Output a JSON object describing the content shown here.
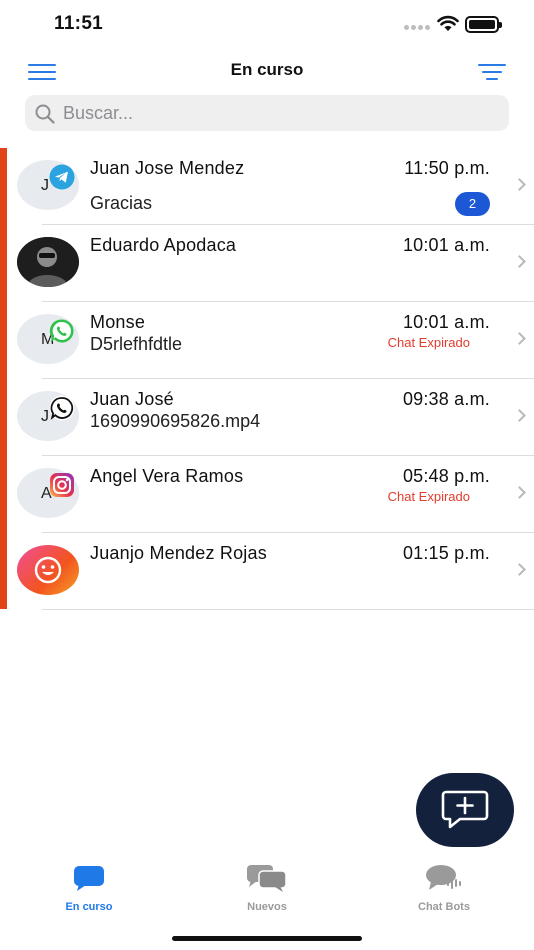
{
  "status_bar": {
    "time": "11:51"
  },
  "header": {
    "title": "En curso"
  },
  "search": {
    "placeholder": "Buscar..."
  },
  "chats": [
    {
      "name": "Juan Jose Mendez",
      "time": "11:50 p.m.",
      "preview": "Gracias",
      "initial": "J",
      "channel": "telegram-icon",
      "unread": "2",
      "expired": ""
    },
    {
      "name": "Eduardo Apodaca",
      "time": "10:01 a.m.",
      "preview": "",
      "initial": "",
      "channel": "",
      "unread": "",
      "expired": ""
    },
    {
      "name": "Monse",
      "time": "10:01 a.m.",
      "preview": "D5rlefhfdtle",
      "initial": "M",
      "channel": "whatsapp-icon",
      "unread": "",
      "expired": "Chat Expirado"
    },
    {
      "name": "Juan José",
      "time": "09:38 a.m.",
      "preview": "1690990695826.mp4",
      "initial": "J",
      "channel": "whatsapp-outline-icon",
      "unread": "",
      "expired": ""
    },
    {
      "name": "Angel Vera Ramos",
      "time": "05:48 p.m.",
      "preview": "",
      "initial": "A",
      "channel": "instagram-icon",
      "unread": "",
      "expired": "Chat Expirado"
    },
    {
      "name": "Juanjo Mendez Rojas",
      "time": "01:15 p.m.",
      "preview": "",
      "initial": "",
      "channel": "",
      "unread": "",
      "expired": ""
    }
  ],
  "tabs": [
    {
      "label": "En curso",
      "icon": "chat-bubble-icon",
      "active": true
    },
    {
      "label": "Nuevos",
      "icon": "chat-bubbles-icon",
      "active": false
    },
    {
      "label": "Chat Bots",
      "icon": "chatbot-icon",
      "active": false
    }
  ],
  "colors": {
    "accent": "#1f7ae8",
    "sidebar_accent": "#e2441a",
    "fab": "#14213d",
    "expired": "#e03c2e",
    "unread_badge": "#1c58d6"
  }
}
